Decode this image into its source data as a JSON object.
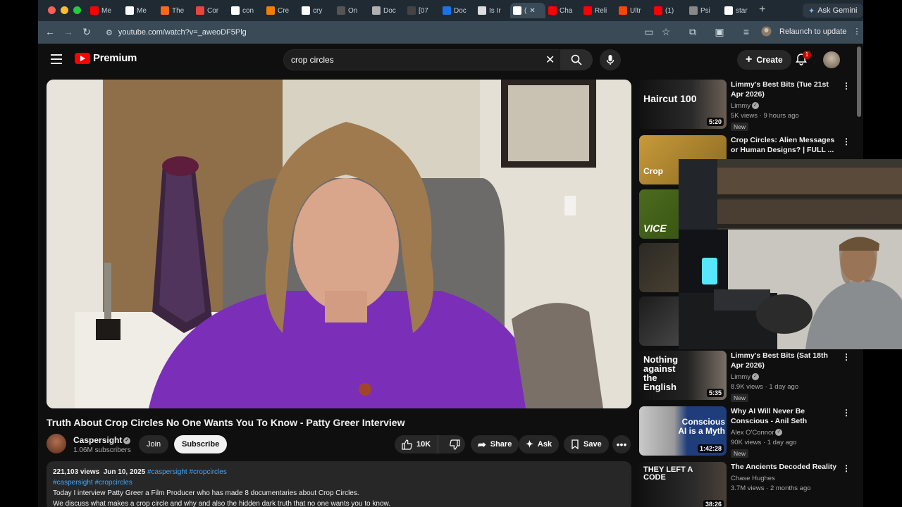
{
  "browser": {
    "traffic_lights": [
      "#ff5f57",
      "#febc2e",
      "#28c840"
    ],
    "tabs": [
      {
        "label": "Me",
        "icon": "youtube-icon",
        "color": "#ff0000"
      },
      {
        "label": "Me",
        "icon": "wikipedia-icon",
        "color": "#ffffff"
      },
      {
        "label": "The",
        "icon": "substack-icon",
        "color": "#ff6719"
      },
      {
        "label": "Cor",
        "icon": "generic-icon",
        "color": "#e8453c"
      },
      {
        "label": "con",
        "icon": "google-icon",
        "color": "#ffffff"
      },
      {
        "label": "Cre",
        "icon": "blogger-icon",
        "color": "#f57d00"
      },
      {
        "label": "cry",
        "icon": "google-icon",
        "color": "#ffffff"
      },
      {
        "label": "On",
        "icon": "generic-icon",
        "color": "#555555"
      },
      {
        "label": "Doc",
        "icon": "medium-icon",
        "color": "#b0b0b0"
      },
      {
        "label": "[07",
        "icon": "generic-icon",
        "color": "#444444"
      },
      {
        "label": "Doc",
        "icon": "generic-icon",
        "color": "#1a73e8"
      },
      {
        "label": "Is Ir",
        "icon": "generic-icon",
        "color": "#dddddd"
      },
      {
        "label": "(",
        "icon": "speaker-icon",
        "color": "#ffffff",
        "active": true
      },
      {
        "label": "Cha",
        "icon": "youtube-icon",
        "color": "#ff0000"
      },
      {
        "label": "Reli",
        "icon": "youtube-icon",
        "color": "#ff0000"
      },
      {
        "label": "Ultr",
        "icon": "reddit-icon",
        "color": "#ff4500"
      },
      {
        "label": "(1)",
        "icon": "youtube-icon",
        "color": "#ff0000"
      },
      {
        "label": "Psi",
        "icon": "generic-icon",
        "color": "#888888"
      },
      {
        "label": "star",
        "icon": "google-icon",
        "color": "#ffffff"
      }
    ],
    "ask_gemini": "Ask Gemini",
    "url": "youtube.com/watch?v=_aweoDF5Plg",
    "relaunch": "Relaunch to update"
  },
  "masthead": {
    "logo_text": "Premium",
    "search_value": "crop circles",
    "create": "Create",
    "notification_count": "1"
  },
  "video": {
    "title": "Truth About Crop Circles No One Wants You To Know - Patty Greer Interview",
    "channel": "Caspersight",
    "subscribers": "1.06M subscribers",
    "join": "Join",
    "subscribe": "Subscribe",
    "likes": "10K",
    "share": "Share",
    "ask": "Ask",
    "save": "Save"
  },
  "description": {
    "views": "221,103 views",
    "date": "Jun 10, 2025",
    "tags_inline": "#caspersight #cropcircles",
    "tags_line": "#caspersight #cropcircles",
    "line1": "Today I interview Patty Greer a Film Producer who has made 8 documentaries about Crop Circles.",
    "line2": "We discuss what makes a crop circle and why and also the hidden dark truth that no one wants you to know."
  },
  "related": [
    {
      "title": "Limmy's Best Bits (Tue 21st Apr 2026)",
      "channel": "Limmy",
      "meta": "5K views · 9 hours ago",
      "badge": "New",
      "duration": "5:20",
      "thumb_text": "Haircut 100"
    },
    {
      "title": "Crop Circles: Alien Messages or Human Designs? | FULL ...",
      "channel": "",
      "meta": "",
      "badge": "",
      "duration": "",
      "thumb_text": "Crop"
    },
    {
      "title": "",
      "channel": "",
      "meta": "",
      "badge": "",
      "duration": "",
      "thumb_text": "VICE"
    },
    {
      "title": "",
      "channel": "",
      "meta": "",
      "badge": "",
      "duration": "",
      "thumb_text": ""
    },
    {
      "title": "",
      "channel": "",
      "meta": "",
      "badge": "",
      "duration": "",
      "thumb_text": ""
    },
    {
      "title": "Limmy's Best Bits (Sat 18th Apr 2026)",
      "channel": "Limmy",
      "meta": "8.9K views · 1 day ago",
      "badge": "New",
      "duration": "5:35",
      "thumb_text": "Nothing against the English"
    },
    {
      "title": "Why AI Will Never Be Conscious - Anil Seth",
      "channel": "Alex O'Connor",
      "meta": "90K views · 1 day ago",
      "badge": "New",
      "duration": "1:42:28",
      "thumb_text": "Conscious AI is a Myth"
    },
    {
      "title": "The Ancients Decoded Reality",
      "channel": "Chase Hughes",
      "meta": "3.7M views · 2 months ago",
      "badge": "",
      "duration": "38:26",
      "thumb_text": "THEY LEFT A CODE"
    }
  ]
}
